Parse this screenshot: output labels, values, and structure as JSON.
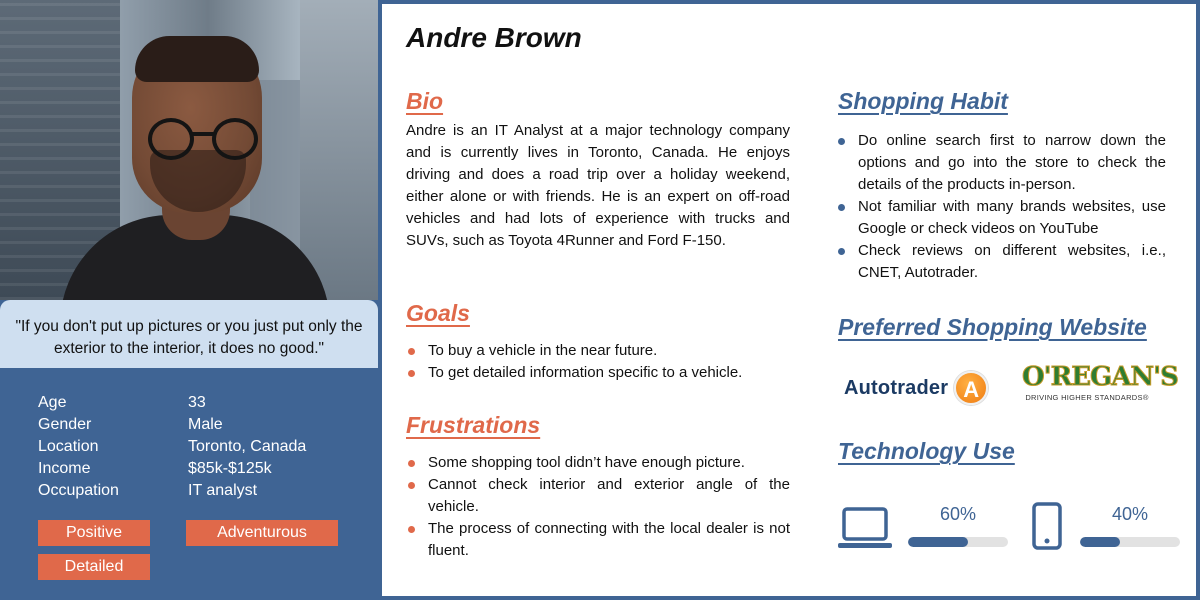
{
  "persona": {
    "name": "Andre Brown",
    "quote": "\"If you don't put up pictures or you just put only the exterior to the interior, it does no good.\"",
    "details": [
      {
        "label": "Age",
        "value": "33"
      },
      {
        "label": "Gender",
        "value": "Male"
      },
      {
        "label": "Location",
        "value": "Toronto, Canada"
      },
      {
        "label": "Income",
        "value": "$85k-$125k"
      },
      {
        "label": "Occupation",
        "value": "IT analyst"
      }
    ],
    "traits": [
      "Positive",
      "Adventurous",
      "Detailed"
    ]
  },
  "bio": {
    "heading": "Bio",
    "text": "Andre is an IT Analyst at a major technology company and is currently lives in Toronto, Canada. He enjoys driving and does a road trip over a holiday weekend, either alone or with friends. He is an expert on off-road vehicles and had lots of experience with trucks and SUVs, such as Toyota 4Runner and Ford F-150."
  },
  "goals": {
    "heading": "Goals",
    "items": [
      "To buy a vehicle in the near future.",
      "To get detailed information specific to a vehicle."
    ]
  },
  "frustrations": {
    "heading": "Frustrations",
    "items": [
      "Some shopping tool didn’t have enough picture.",
      "Cannot check interior and exterior angle of the vehicle.",
      "The process of connecting with the local dealer is not fluent."
    ]
  },
  "shopping_habit": {
    "heading": "Shopping Habit",
    "items": [
      "Do online search first to narrow down the options and go into the store to check the details of the products in-person.",
      "Not familiar with many brands websites, use Google or check videos on YouTube",
      "Check reviews on different websites, i.e., CNET, Autotrader."
    ]
  },
  "preferred_websites": {
    "heading": "Preferred Shopping Website",
    "logos": [
      {
        "name": "Autotrader",
        "badge": "A"
      },
      {
        "name": "O'REGAN'S",
        "tagline": "DRIVING HIGHER STANDARDS®"
      }
    ]
  },
  "technology_use": {
    "heading": "Technology Use",
    "devices": [
      {
        "icon": "laptop-icon",
        "percent_label": "60%",
        "level": 0.6
      },
      {
        "icon": "smartphone-icon",
        "percent_label": "40%",
        "level": 0.4
      }
    ]
  },
  "colors": {
    "accent_orange": "#e0694a",
    "accent_blue": "#3f6494",
    "quote_bg": "#cfdff0"
  }
}
